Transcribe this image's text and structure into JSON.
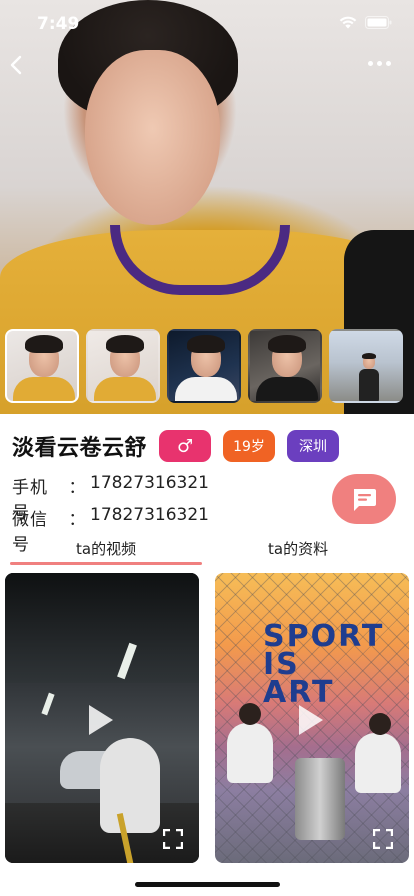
{
  "status_bar": {
    "time": "7:49"
  },
  "header": {
    "back_icon": "chevron-left-icon",
    "more_icon": "more-horizontal-icon"
  },
  "gallery": {
    "thumbnails": [
      {
        "alt": "photo-1",
        "active": true
      },
      {
        "alt": "photo-2",
        "active": false
      },
      {
        "alt": "photo-3",
        "active": false
      },
      {
        "alt": "photo-4",
        "active": false
      },
      {
        "alt": "photo-5",
        "active": false
      }
    ]
  },
  "profile": {
    "name": "淡看云卷云舒",
    "gender_symbol": "♂",
    "age": "19岁",
    "city": "深圳",
    "phone_label": "手机号",
    "phone_separator": "：",
    "phone": "17827316321",
    "wechat_label": "微信号",
    "wechat_separator": "：",
    "wechat": "17827316321"
  },
  "tabs": [
    {
      "label": "ta的视频",
      "active": true
    },
    {
      "label": "ta的资料",
      "active": false
    }
  ],
  "videos": [
    {
      "title": "",
      "play_icon": "play-icon",
      "fullscreen_icon": "fullscreen-icon"
    },
    {
      "title": "",
      "overlay_text": [
        "SPORT",
        "IS",
        "ART"
      ],
      "play_icon": "play-icon",
      "fullscreen_icon": "fullscreen-icon"
    }
  ],
  "colors": {
    "accent": "#f0807f",
    "gender_tag": "#e8336e",
    "age_tag": "#f06324",
    "city_tag": "#6b3fbf"
  }
}
